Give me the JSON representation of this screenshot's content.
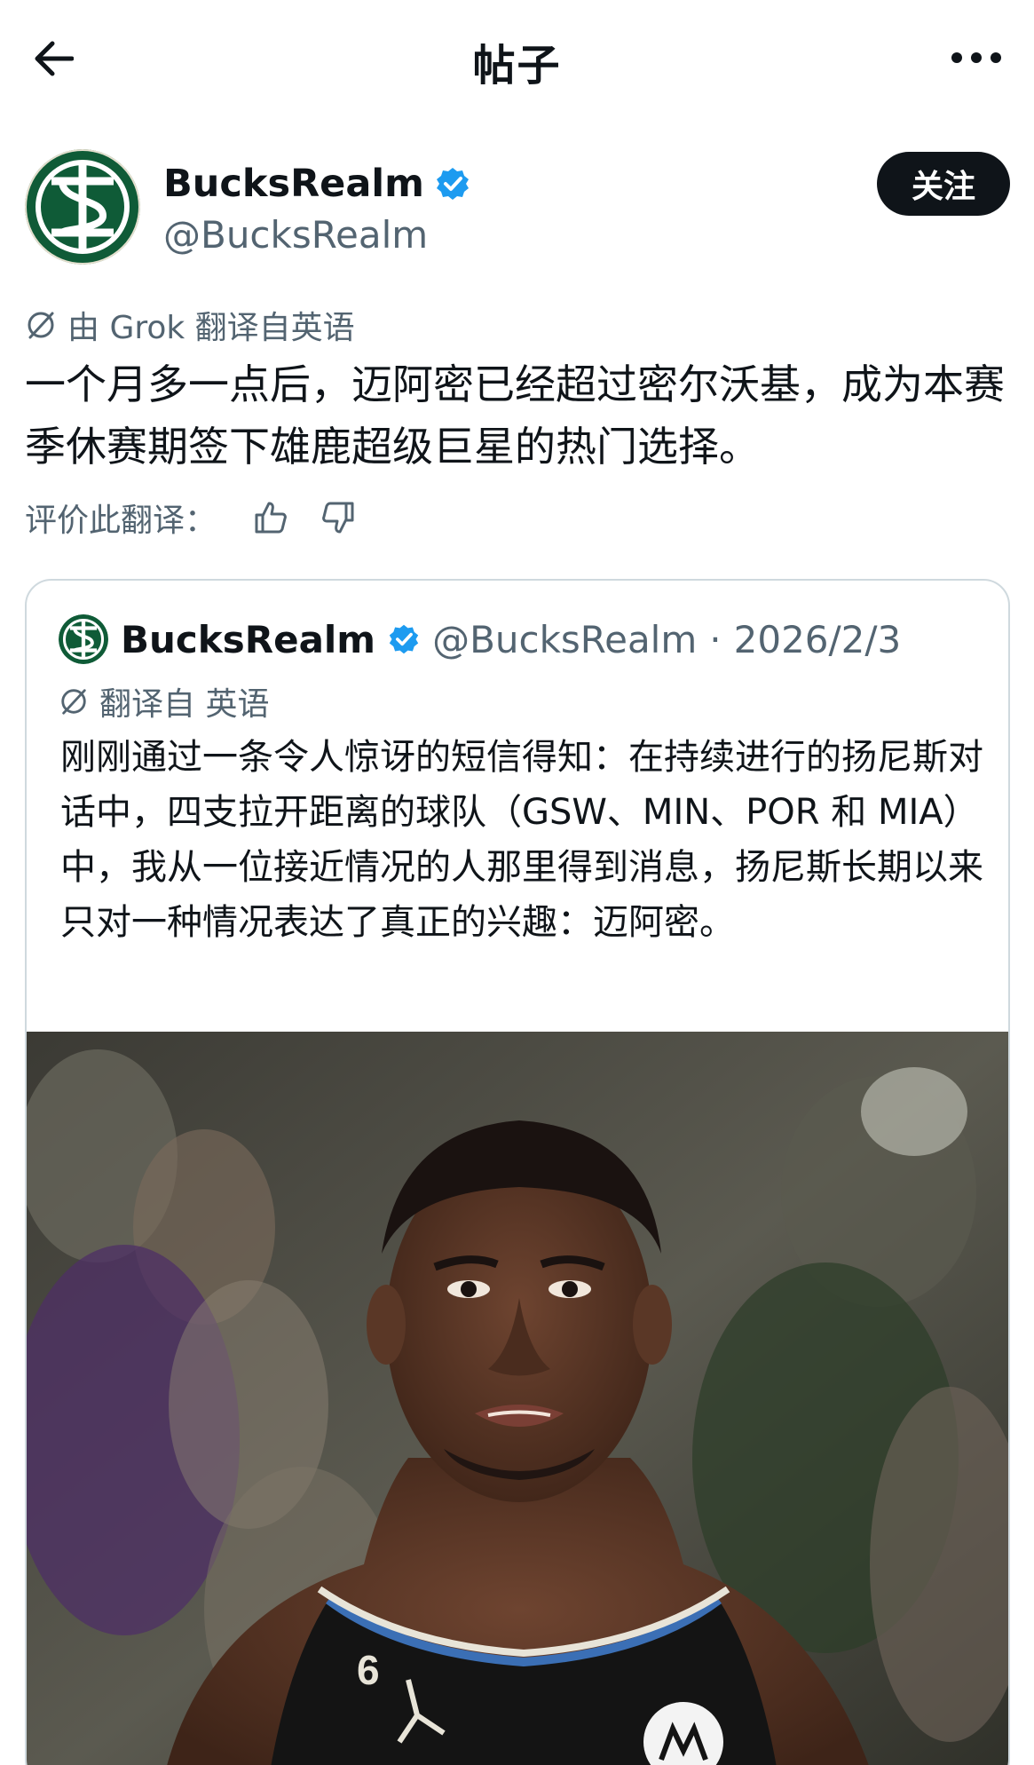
{
  "header": {
    "title": "帖子"
  },
  "post": {
    "author_name": "BucksRealm",
    "author_handle": "@BucksRealm",
    "follow_label": "关注",
    "translated_by": "由 Grok 翻译自英语",
    "text": "一个月多一点后，迈阿密已经超过密尔沃基，成为本赛季休赛期签下雄鹿超级巨星的热门选择。",
    "rate_label": "评价此翻译："
  },
  "quote": {
    "author_name": "BucksRealm",
    "author_handle": "@BucksRealm",
    "separator": "·",
    "date": "2026/2/3",
    "translated_label": "翻译自 英语",
    "text": "刚刚通过一条令人惊讶的短信得知：在持续进行的扬尼斯对话中，四支拉开距离的球队（GSW、MIN、POR 和 MIA）中，我从一位接近情况的人那里得到消息，扬尼斯长期以来只对一种情况表达了真正的兴趣：迈阿密。",
    "photo": {
      "jersey_number": "6"
    }
  },
  "colors": {
    "brand_green": "#0f5b37",
    "verified_blue": "#1d9bf0",
    "text_primary": "#0f1419",
    "text_secondary": "#536471",
    "border": "#cfd9de"
  },
  "icons": [
    "back-arrow-icon",
    "more-icon",
    "verified-badge-icon",
    "translate-icon",
    "thumbs-up-icon",
    "thumbs-down-icon"
  ]
}
